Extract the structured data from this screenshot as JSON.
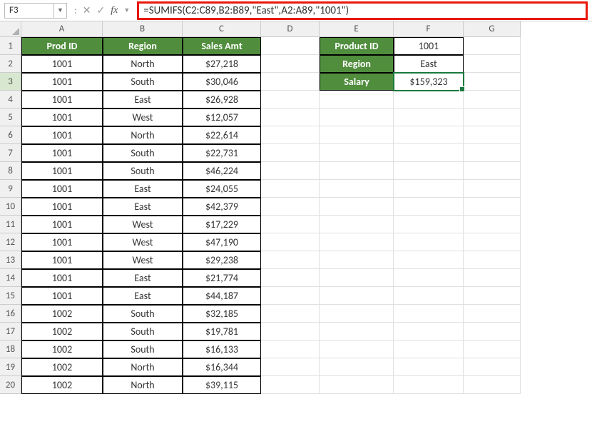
{
  "nameBox": "F3",
  "formula": "=SUMIFS(C2:C89,B2:B89,\"East\",A2:A89,\"1001\")",
  "cols": [
    "A",
    "B",
    "C",
    "D",
    "E",
    "F",
    "G"
  ],
  "headers": {
    "prod": "Prod ID",
    "region": "Region",
    "sales": "Sales Amt"
  },
  "rows": [
    {
      "n": "1"
    },
    {
      "n": "2",
      "p": "1001",
      "r": "North",
      "s": "$27,218"
    },
    {
      "n": "3",
      "p": "1001",
      "r": "South",
      "s": "$30,046"
    },
    {
      "n": "4",
      "p": "1001",
      "r": "East",
      "s": "$26,928"
    },
    {
      "n": "5",
      "p": "1001",
      "r": "West",
      "s": "$12,057"
    },
    {
      "n": "6",
      "p": "1001",
      "r": "North",
      "s": "$22,614"
    },
    {
      "n": "7",
      "p": "1001",
      "r": "South",
      "s": "$22,731"
    },
    {
      "n": "8",
      "p": "1001",
      "r": "South",
      "s": "$46,224"
    },
    {
      "n": "9",
      "p": "1001",
      "r": "East",
      "s": "$24,055"
    },
    {
      "n": "10",
      "p": "1001",
      "r": "East",
      "s": "$42,379"
    },
    {
      "n": "11",
      "p": "1001",
      "r": "West",
      "s": "$17,229"
    },
    {
      "n": "12",
      "p": "1001",
      "r": "West",
      "s": "$47,190"
    },
    {
      "n": "13",
      "p": "1001",
      "r": "West",
      "s": "$29,238"
    },
    {
      "n": "14",
      "p": "1001",
      "r": "East",
      "s": "$21,774"
    },
    {
      "n": "15",
      "p": "1001",
      "r": "East",
      "s": "$44,187"
    },
    {
      "n": "16",
      "p": "1002",
      "r": "South",
      "s": "$32,185"
    },
    {
      "n": "17",
      "p": "1002",
      "r": "South",
      "s": "$19,781"
    },
    {
      "n": "18",
      "p": "1002",
      "r": "South",
      "s": "$16,133"
    },
    {
      "n": "19",
      "p": "1002",
      "r": "North",
      "s": "$16,344"
    },
    {
      "n": "20",
      "p": "1002",
      "r": "North",
      "s": "$39,115"
    }
  ],
  "lookup": [
    {
      "label": "Product ID",
      "value": "1001"
    },
    {
      "label": "Region",
      "value": "East"
    },
    {
      "label": "Salary",
      "value": "$159,323"
    }
  ],
  "icons": {
    "dd": "▼",
    "sep": ":",
    "cancel": "✕",
    "enter": "✓",
    "fx": "fx"
  }
}
